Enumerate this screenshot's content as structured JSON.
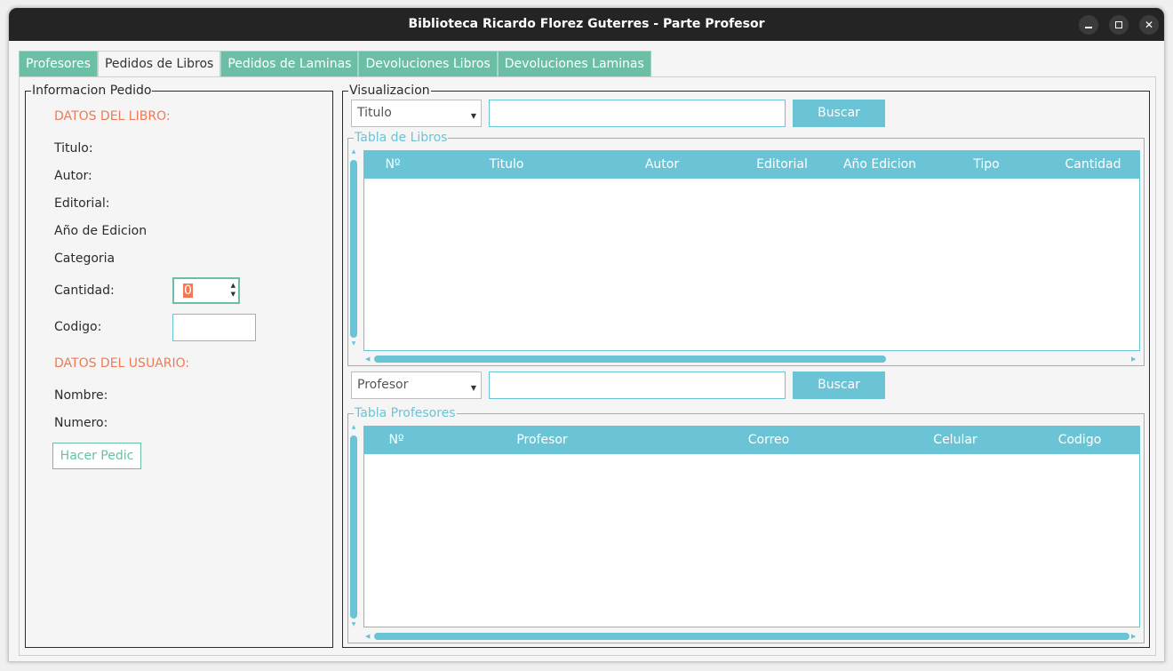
{
  "window": {
    "title": "Biblioteca Ricardo Florez Guterres - Parte Profesor",
    "close_glyph": "✕"
  },
  "tabs": [
    {
      "label": "Profesores"
    },
    {
      "label": "Pedidos de Libros"
    },
    {
      "label": "Pedidos de Laminas"
    },
    {
      "label": "Devoluciones Libros"
    },
    {
      "label": "Devoluciones Laminas"
    }
  ],
  "info": {
    "legend": "Informacion Pedido",
    "book_section": "DATOS DEL LIBRO:",
    "titulo": "Titulo:",
    "autor": "Autor:",
    "editorial": "Editorial:",
    "anio": "Año de Edicion",
    "categoria": "Categoria",
    "cantidad": "Cantidad:",
    "cantidad_value": "0",
    "codigo": "Codigo:",
    "user_section": "DATOS DEL USUARIO:",
    "nombre": "Nombre:",
    "numero": "Numero:",
    "submit_label": "Hacer Pedic"
  },
  "visual": {
    "legend": "Visualizacion",
    "books_filter": {
      "selected": "Titulo",
      "search_label": "Buscar"
    },
    "books_table": {
      "legend": "Tabla de Libros",
      "columns": [
        "Nº",
        "Titulo",
        "Autor",
        "Editorial",
        "Año Edicion",
        "Tipo",
        "Cantidad"
      ]
    },
    "prof_filter": {
      "selected": "Profesor",
      "search_label": "Buscar"
    },
    "prof_table": {
      "legend": "Tabla Profesores",
      "columns": [
        "Nº",
        "Profesor",
        "Correo",
        "Celular",
        "Codigo"
      ]
    }
  },
  "colors": {
    "accent": "#6bc4d6",
    "tab_green": "#6bbfa7",
    "section_orange": "#f07a54"
  }
}
